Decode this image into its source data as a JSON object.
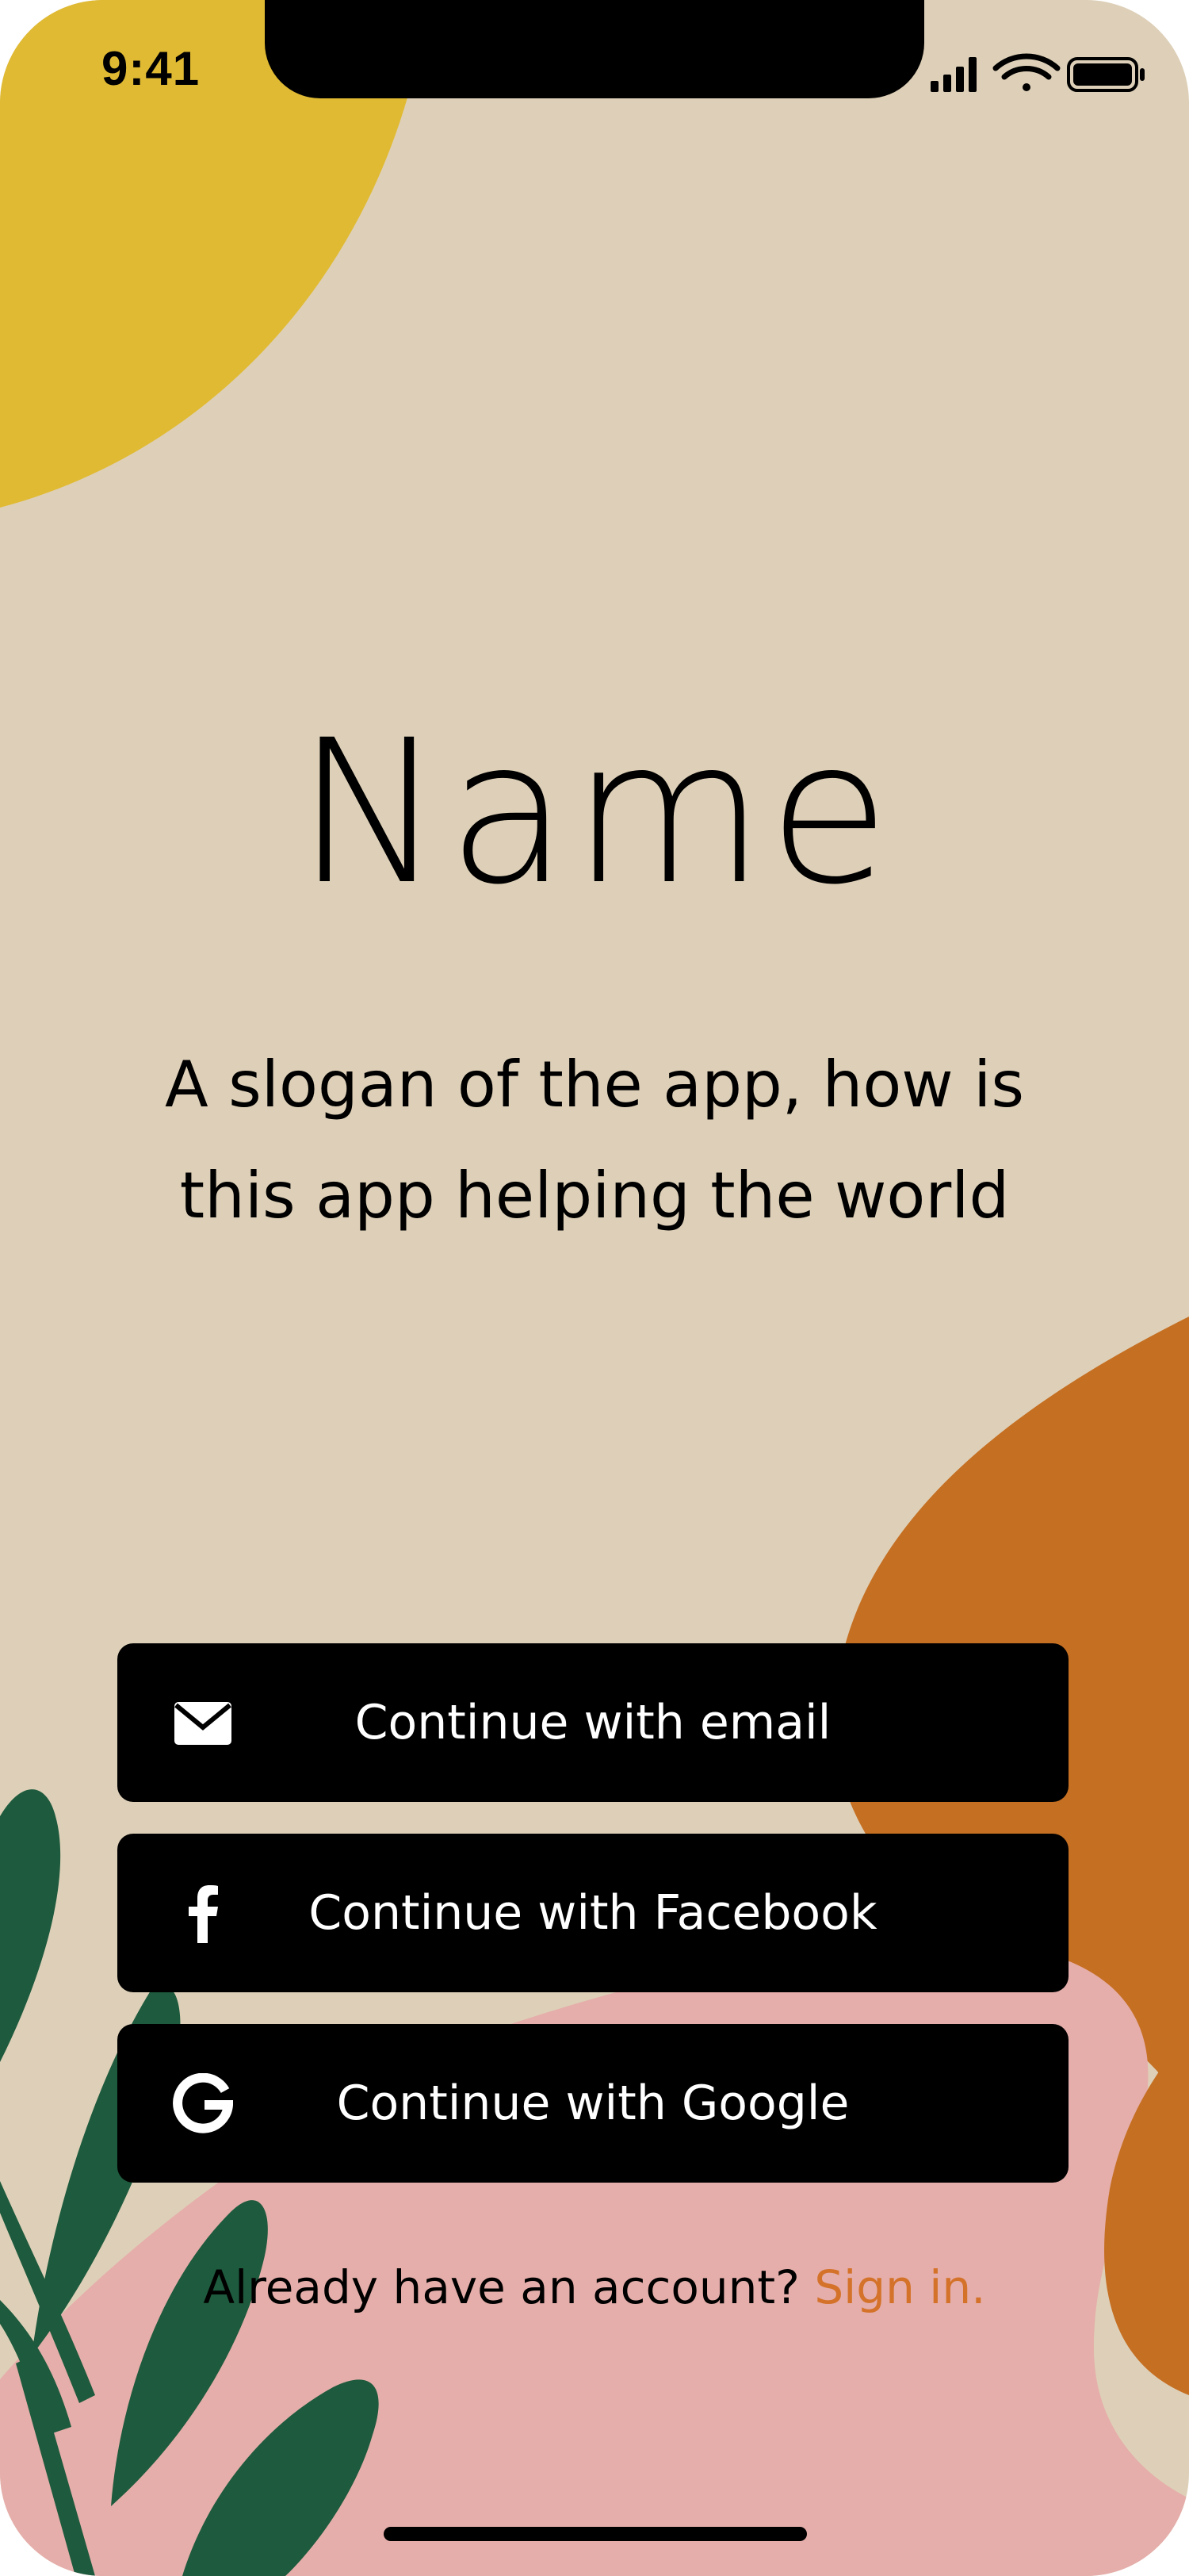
{
  "status_bar": {
    "time": "9:41",
    "signal_icon": "cellular-signal-icon",
    "wifi_icon": "wifi-icon",
    "battery_icon": "battery-icon"
  },
  "hero": {
    "app_name": "Name",
    "slogan": "A slogan of the app, how is this app helping the world"
  },
  "auth": {
    "email": {
      "label": "Continue with email",
      "icon": "mail-icon"
    },
    "facebook": {
      "label": "Continue with Facebook",
      "icon": "facebook-icon"
    },
    "google": {
      "label": "Continue with Google",
      "icon": "google-icon"
    }
  },
  "footer": {
    "prompt": "Already have an account?",
    "sign_in": "Sign in."
  },
  "colors": {
    "background": "#ded0b8",
    "yellow_blob": "#e0ba33",
    "orange_blob": "#c56f22",
    "pink_blob": "#e5aeaa",
    "leaf_green": "#1e5a3d",
    "accent_link": "#d4722a",
    "button": "#000000"
  }
}
